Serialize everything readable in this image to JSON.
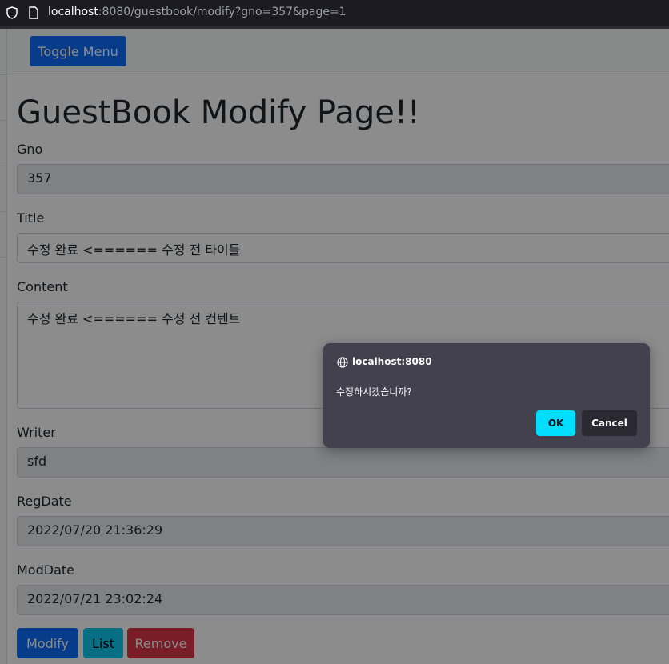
{
  "browser": {
    "url_host": "localhost",
    "url_path": ":8080/guestbook/modify?gno=357&page=1"
  },
  "nav": {
    "toggle_label": "Toggle Menu"
  },
  "page": {
    "title": "GuestBook Modify Page!!"
  },
  "form": {
    "gno_label": "Gno",
    "gno_value": "357",
    "title_label": "Title",
    "title_value": "수정 완료 <====== 수정 전 타이틀",
    "content_label": "Content",
    "content_value": "수정 완료 <====== 수정 전 컨텐트",
    "writer_label": "Writer",
    "writer_value": "sfd",
    "regdate_label": "RegDate",
    "regdate_value": "2022/07/20 21:36:29",
    "moddate_label": "ModDate",
    "moddate_value": "2022/07/21 23:02:24"
  },
  "actions": {
    "modify_label": "Modify",
    "list_label": "List",
    "remove_label": "Remove"
  },
  "dialog": {
    "origin": "localhost:8080",
    "message": "수정하시겠습니까?",
    "ok_label": "OK",
    "cancel_label": "Cancel"
  },
  "colors": {
    "primary": "#0d6efd",
    "info": "#0dcaf0",
    "danger": "#dc3545",
    "dialog_bg": "#42414d",
    "dialog_ok": "#00ddff"
  }
}
